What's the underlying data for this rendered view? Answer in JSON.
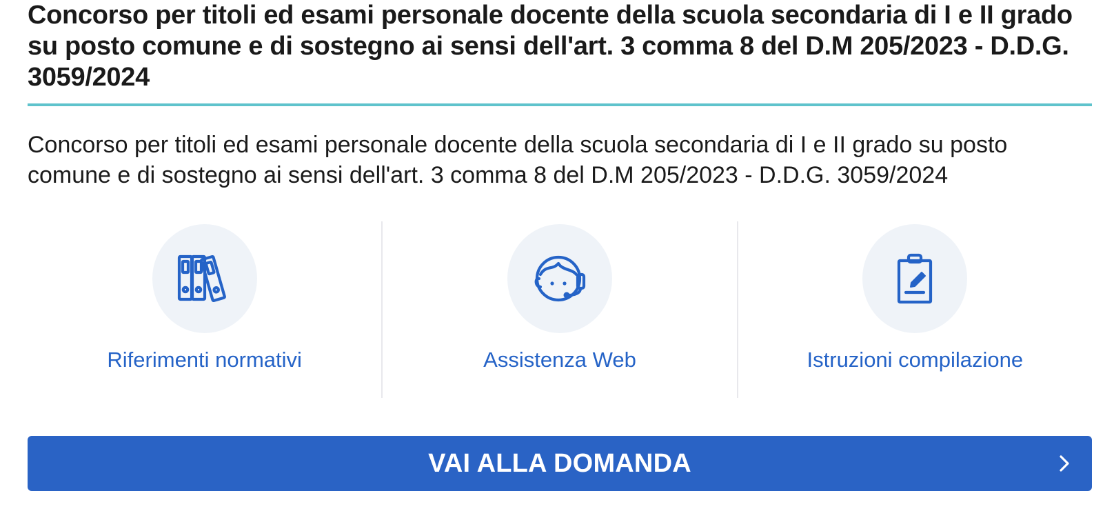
{
  "header": {
    "title": "Concorso per titoli ed esami personale docente della scuola secondaria di I e II grado su posto comune e di sostegno ai sensi dell'art. 3 comma 8 del D.M 205/2023 - D.D.G. 3059/2024"
  },
  "main": {
    "description": "Concorso per titoli ed esami personale docente della scuola secondaria di I e II grado su posto comune e di sostegno ai sensi dell'art. 3 comma 8 del D.M 205/2023 - D.D.G. 3059/2024",
    "cards": [
      {
        "label": "Riferimenti normativi",
        "icon": "binders-icon"
      },
      {
        "label": "Assistenza Web",
        "icon": "headset-support-icon"
      },
      {
        "label": "Istruzioni compilazione",
        "icon": "clipboard-edit-icon"
      }
    ],
    "cta": {
      "label": "VAI ALLA DOMANDA",
      "icon": "chevron-right-icon"
    }
  },
  "colors": {
    "accent_rule": "#5fc3cc",
    "link": "#2563c7",
    "button": "#2a63c5",
    "icon_bg": "#eff3f8",
    "text": "#1a1a1a"
  }
}
